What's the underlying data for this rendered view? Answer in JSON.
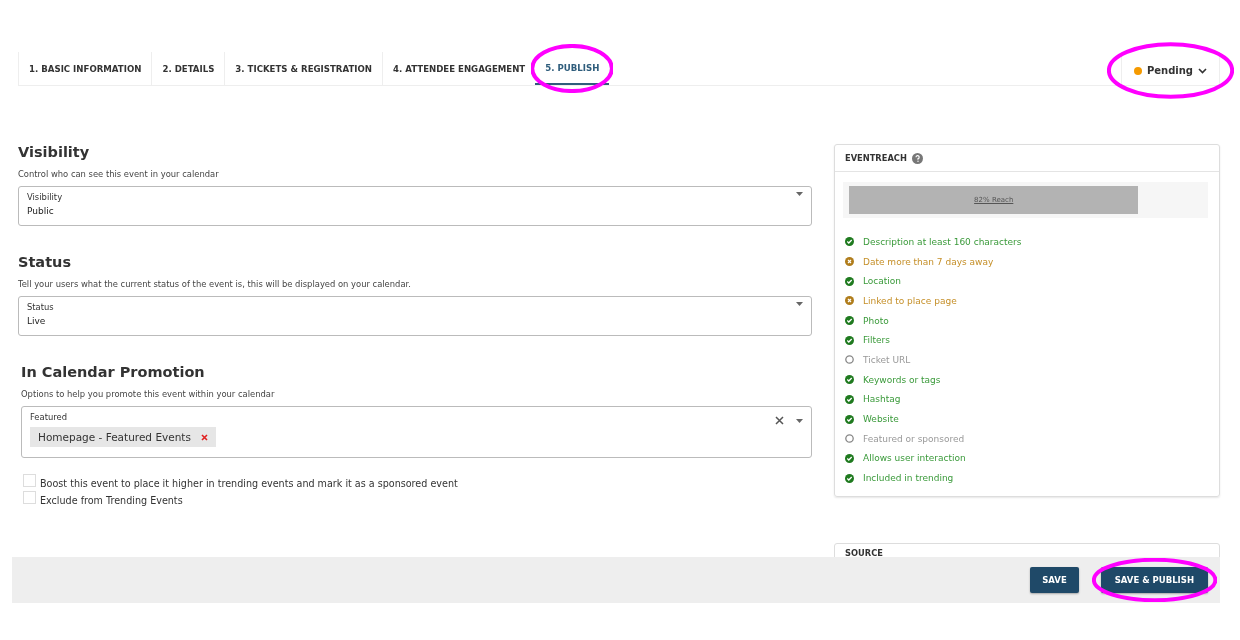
{
  "tabs": [
    {
      "label": "1. BASIC INFORMATION",
      "selected": false,
      "highlighted": false
    },
    {
      "label": "2. DETAILS",
      "selected": false,
      "highlighted": false
    },
    {
      "label": "3. TICKETS & REGISTRATION",
      "selected": false,
      "highlighted": false
    },
    {
      "label": "4. ATTENDEE ENGAGEMENT",
      "selected": false,
      "highlighted": false
    },
    {
      "label": "5. PUBLISH",
      "selected": true,
      "highlighted": true
    }
  ],
  "status_menu": {
    "label": "Pending",
    "color": "#f59a00",
    "highlighted": true
  },
  "sections": [
    {
      "kind": "select",
      "title": "Visibility",
      "description": "Control who can see this event in your calendar",
      "field_label": "Visibility",
      "value": "Public"
    },
    {
      "kind": "select",
      "title": "Status",
      "description": "Tell your users what the current status of the event is, this will be displayed on your calendar.",
      "field_label": "Status",
      "value": "Live"
    },
    {
      "kind": "tags",
      "title": "In Calendar Promotion",
      "description": "Options to help you promote this event within your calendar",
      "field_label": "Featured",
      "tags": [
        "Homepage - Featured Events"
      ]
    }
  ],
  "checkboxes": [
    {
      "label": "Boost this event to place it higher in trending events and mark it as a sponsored event",
      "checked": false
    },
    {
      "label": "Exclude from Trending Events",
      "checked": false
    }
  ],
  "eventreach": {
    "title": "EVENTREACH",
    "reach_label": "82% Reach",
    "level": 0.82,
    "items": [
      {
        "label": "Description at least 160 characters",
        "kind": "done"
      },
      {
        "label": "Date more than 7 days away",
        "kind": "warning"
      },
      {
        "label": "Location",
        "kind": "done"
      },
      {
        "label": "Linked to place page",
        "kind": "warning"
      },
      {
        "label": "Photo",
        "kind": "done"
      },
      {
        "label": "Filters",
        "kind": "done"
      },
      {
        "label": "Ticket URL",
        "kind": "missing"
      },
      {
        "label": "Keywords or tags",
        "kind": "done"
      },
      {
        "label": "Hashtag",
        "kind": "done"
      },
      {
        "label": "Website",
        "kind": "done"
      },
      {
        "label": "Featured or sponsored",
        "kind": "missing"
      },
      {
        "label": "Allows user interaction",
        "kind": "done"
      },
      {
        "label": "Included in trending",
        "kind": "done"
      }
    ]
  },
  "source": {
    "title": "SOURCE"
  },
  "buttons": [
    {
      "label": "SAVE",
      "highlighted": false
    },
    {
      "label": "SAVE & PUBLISH",
      "highlighted": true
    }
  ]
}
